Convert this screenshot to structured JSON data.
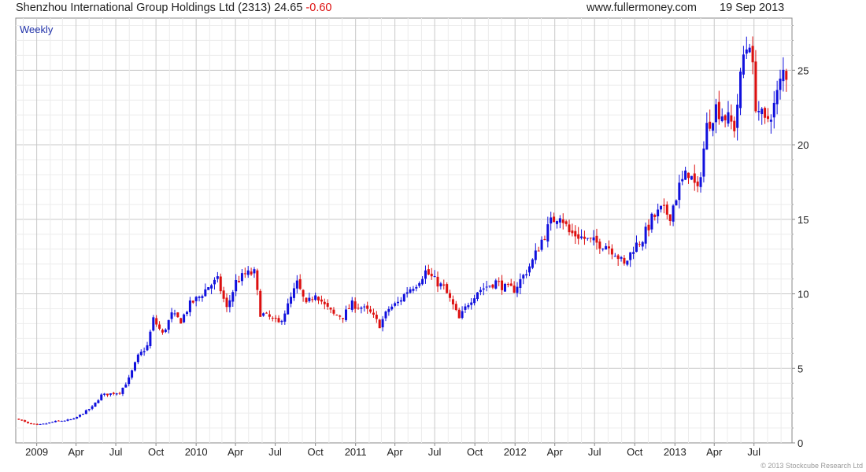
{
  "header": {
    "company": "Shenzhou International Group Holdings Ltd (2313)",
    "price": "24.65",
    "change": "-0.60",
    "website": "www.fullermoney.com",
    "date": "19 Sep 2013"
  },
  "chart_data": {
    "type": "candlestick",
    "period_label": "Weekly",
    "copyright": "© 2013 Stockcube Research Ltd",
    "x_tick_labels": [
      "2009",
      "Apr",
      "Jul",
      "Oct",
      "2010",
      "Apr",
      "Jul",
      "Oct",
      "2011",
      "Apr",
      "Jul",
      "Oct",
      "2012",
      "Apr",
      "Jul",
      "Oct",
      "2013",
      "Apr",
      "Jul"
    ],
    "y_tick_labels": [
      "0",
      "5",
      "10",
      "15",
      "20",
      "25"
    ],
    "ylim": [
      0,
      28.5
    ],
    "up_color": "#1010dd",
    "down_color": "#dd1010",
    "grid": true,
    "price_series": [
      [
        "2008-11-21",
        1.6
      ],
      [
        "2008-12-12",
        1.3
      ],
      [
        "2009-01-02",
        1.2
      ],
      [
        "2009-01-23",
        1.3
      ],
      [
        "2009-02-13",
        1.45
      ],
      [
        "2009-03-06",
        1.5
      ],
      [
        "2009-03-27",
        1.6
      ],
      [
        "2009-04-17",
        2.0
      ],
      [
        "2009-05-08",
        2.4
      ],
      [
        "2009-05-29",
        3.2
      ],
      [
        "2009-06-19",
        3.3
      ],
      [
        "2009-07-10",
        3.4
      ],
      [
        "2009-07-31",
        4.3
      ],
      [
        "2009-08-21",
        5.8
      ],
      [
        "2009-09-11",
        6.5
      ],
      [
        "2009-09-25",
        8.3
      ],
      [
        "2009-10-16",
        7.3
      ],
      [
        "2009-11-06",
        8.6
      ],
      [
        "2009-11-27",
        8.2
      ],
      [
        "2009-12-18",
        9.3
      ],
      [
        "2010-01-08",
        9.8
      ],
      [
        "2010-01-29",
        10.5
      ],
      [
        "2010-02-19",
        10.9
      ],
      [
        "2010-03-12",
        9.0
      ],
      [
        "2010-04-02",
        10.8
      ],
      [
        "2010-04-23",
        11.3
      ],
      [
        "2010-05-14",
        11.4
      ],
      [
        "2010-05-28",
        8.7
      ],
      [
        "2010-06-18",
        8.4
      ],
      [
        "2010-07-09",
        8.0
      ],
      [
        "2010-07-30",
        9.2
      ],
      [
        "2010-08-20",
        10.7
      ],
      [
        "2010-09-10",
        9.2
      ],
      [
        "2010-10-01",
        10.1
      ],
      [
        "2010-10-22",
        9.2
      ],
      [
        "2010-11-12",
        8.6
      ],
      [
        "2010-12-03",
        8.5
      ],
      [
        "2010-12-24",
        9.3
      ],
      [
        "2011-01-14",
        9.1
      ],
      [
        "2011-02-04",
        8.7
      ],
      [
        "2011-02-25",
        7.9
      ],
      [
        "2011-03-18",
        9.0
      ],
      [
        "2011-04-08",
        9.4
      ],
      [
        "2011-04-29",
        10.2
      ],
      [
        "2011-05-20",
        10.7
      ],
      [
        "2011-06-10",
        11.5
      ],
      [
        "2011-07-01",
        10.9
      ],
      [
        "2011-07-22",
        10.4
      ],
      [
        "2011-08-12",
        9.2
      ],
      [
        "2011-08-26",
        8.3
      ],
      [
        "2011-09-16",
        9.4
      ],
      [
        "2011-10-07",
        10.2
      ],
      [
        "2011-10-28",
        10.5
      ],
      [
        "2011-11-18",
        10.8
      ],
      [
        "2011-12-09",
        10.4
      ],
      [
        "2011-12-30",
        10.3
      ],
      [
        "2012-01-20",
        11.2
      ],
      [
        "2012-02-10",
        12.2
      ],
      [
        "2012-03-02",
        13.6
      ],
      [
        "2012-03-23",
        14.8
      ],
      [
        "2012-04-13",
        15.4
      ],
      [
        "2012-05-04",
        14.1
      ],
      [
        "2012-05-25",
        13.9
      ],
      [
        "2012-06-15",
        13.6
      ],
      [
        "2012-07-06",
        13.4
      ],
      [
        "2012-07-27",
        13.3
      ],
      [
        "2012-08-17",
        12.8
      ],
      [
        "2012-09-07",
        11.9
      ],
      [
        "2012-09-28",
        13.1
      ],
      [
        "2012-10-19",
        13.7
      ],
      [
        "2012-11-09",
        15.0
      ],
      [
        "2012-11-30",
        15.6
      ],
      [
        "2012-12-21",
        15.3
      ],
      [
        "2013-01-11",
        17.2
      ],
      [
        "2013-02-01",
        18.2
      ],
      [
        "2013-02-22",
        16.8
      ],
      [
        "2013-03-15",
        21.2
      ],
      [
        "2013-04-05",
        22.5
      ],
      [
        "2013-04-26",
        21.9
      ],
      [
        "2013-05-17",
        21.2
      ],
      [
        "2013-06-07",
        26.0
      ],
      [
        "2013-06-21",
        27.1
      ],
      [
        "2013-07-05",
        22.8
      ],
      [
        "2013-07-26",
        21.4
      ],
      [
        "2013-08-16",
        22.6
      ],
      [
        "2013-09-06",
        24.9
      ],
      [
        "2013-09-19",
        24.65
      ]
    ]
  }
}
